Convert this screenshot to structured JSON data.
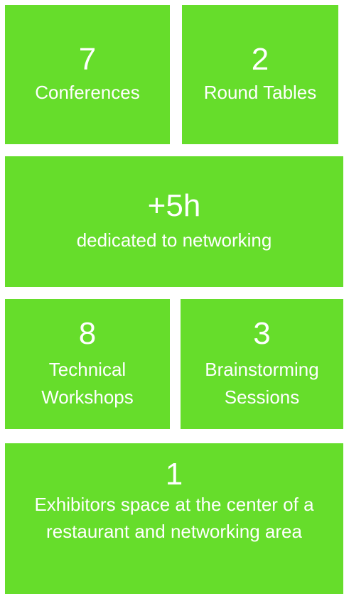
{
  "tiles": [
    {
      "number": "7",
      "label": "Conferences"
    },
    {
      "number": "2",
      "label": "Round Tables"
    },
    {
      "number": "+5h",
      "label": "dedicated to networking"
    },
    {
      "number": "8",
      "label": "Technical\nWorkshops"
    },
    {
      "number": "3",
      "label": "Brainstorming\nSessions"
    },
    {
      "number": "1",
      "label": "Exhibitors space at the center of a\nrestaurant and networking area"
    }
  ],
  "colors": {
    "tile": "#66dd2b",
    "text": "#ffffff"
  }
}
